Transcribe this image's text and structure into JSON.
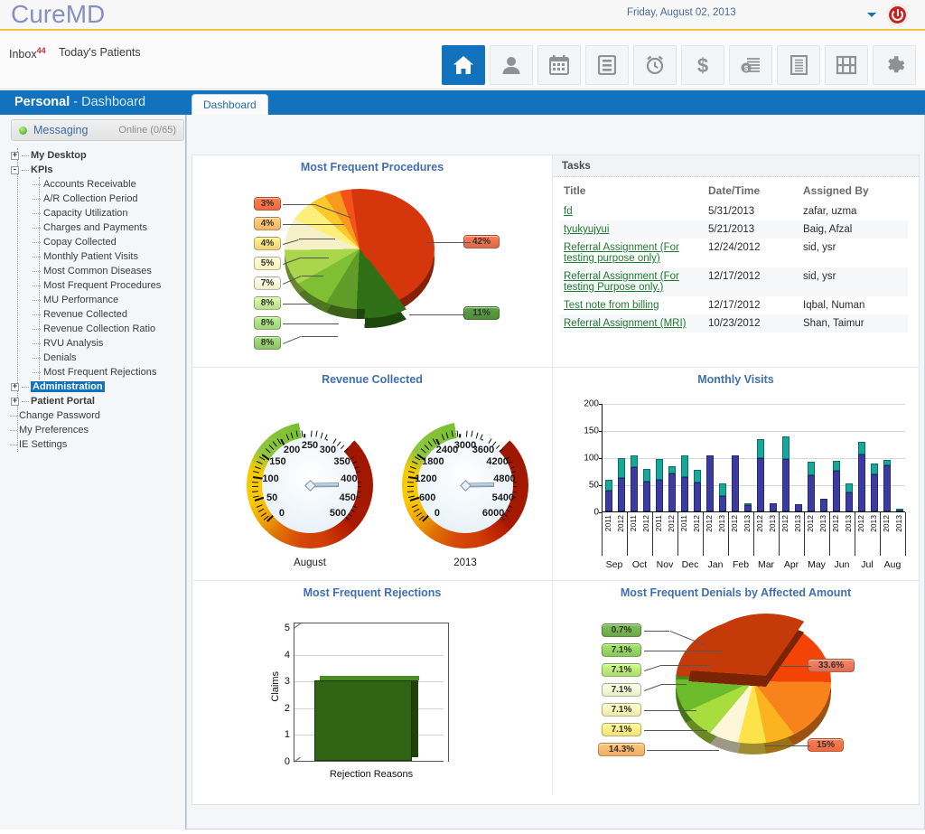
{
  "app": {
    "brand": "CureMD",
    "date": "Friday, August 02, 2013",
    "power_icon": "power-icon",
    "caret_icon": "chevron-down-icon"
  },
  "navbar": {
    "inbox_label": "Inbox",
    "inbox_count": "44",
    "todays_patients": "Today's Patients",
    "toolbar": [
      {
        "name": "home-icon",
        "label": "Home",
        "active": true
      },
      {
        "name": "patient-icon",
        "label": "Patients",
        "active": false
      },
      {
        "name": "calendar-icon",
        "label": "Scheduler",
        "active": false
      },
      {
        "name": "server-icon",
        "label": "Records",
        "active": false
      },
      {
        "name": "alarm-clock-icon",
        "label": "Reminders",
        "active": false
      },
      {
        "name": "dollar-icon",
        "label": "Billing",
        "active": false
      },
      {
        "name": "invoice-icon",
        "label": "Claims",
        "active": false
      },
      {
        "name": "document-icon",
        "label": "Reports",
        "active": false
      },
      {
        "name": "film-icon",
        "label": "Media",
        "active": false
      },
      {
        "name": "gear-icon",
        "label": "Settings",
        "active": false
      }
    ]
  },
  "sidebar": {
    "header_bold": "Personal",
    "header_rest": " - Dashboard",
    "messaging": {
      "label": "Messaging",
      "status": "Online (0/65)"
    },
    "tree": [
      {
        "label": "My Desktop",
        "level": 0,
        "expander": "+",
        "bold": true,
        "highlight": false
      },
      {
        "label": "KPIs",
        "level": 0,
        "expander": "-",
        "bold": true,
        "highlight": false
      },
      {
        "label": "Accounts Receivable",
        "level": 1,
        "expander": "",
        "bold": false,
        "highlight": false
      },
      {
        "label": "A/R Collection Period",
        "level": 1,
        "expander": "",
        "bold": false,
        "highlight": false
      },
      {
        "label": "Capacity Utilization",
        "level": 1,
        "expander": "",
        "bold": false,
        "highlight": false
      },
      {
        "label": "Charges and Payments",
        "level": 1,
        "expander": "",
        "bold": false,
        "highlight": false
      },
      {
        "label": "Copay Collected",
        "level": 1,
        "expander": "",
        "bold": false,
        "highlight": false
      },
      {
        "label": "Monthly Patient Visits",
        "level": 1,
        "expander": "",
        "bold": false,
        "highlight": false
      },
      {
        "label": "Most Common Diseases",
        "level": 1,
        "expander": "",
        "bold": false,
        "highlight": false
      },
      {
        "label": "Most Frequent Procedures",
        "level": 1,
        "expander": "",
        "bold": false,
        "highlight": false
      },
      {
        "label": "MU Performance",
        "level": 1,
        "expander": "",
        "bold": false,
        "highlight": false
      },
      {
        "label": "Revenue Collected",
        "level": 1,
        "expander": "",
        "bold": false,
        "highlight": false
      },
      {
        "label": "Revenue Collection Ratio",
        "level": 1,
        "expander": "",
        "bold": false,
        "highlight": false
      },
      {
        "label": "RVU Analysis",
        "level": 1,
        "expander": "",
        "bold": false,
        "highlight": false
      },
      {
        "label": "Denials",
        "level": 1,
        "expander": "",
        "bold": false,
        "highlight": false
      },
      {
        "label": "Most Frequent Rejections",
        "level": 1,
        "expander": "",
        "bold": false,
        "highlight": false
      },
      {
        "label": "Administration",
        "level": 0,
        "expander": "+",
        "bold": true,
        "highlight": true
      },
      {
        "label": "Patient Portal",
        "level": 0,
        "expander": "+",
        "bold": true,
        "highlight": false
      },
      {
        "label": "Change Password",
        "level": 2,
        "expander": "",
        "bold": false,
        "highlight": false
      },
      {
        "label": "My Preferences",
        "level": 2,
        "expander": "",
        "bold": false,
        "highlight": false
      },
      {
        "label": "IE Settings",
        "level": 2,
        "expander": "",
        "bold": false,
        "highlight": false
      }
    ]
  },
  "main": {
    "tab_label": "Dashboard",
    "tasks": {
      "panel_title": "Tasks",
      "columns": [
        "Title",
        "Date/Time",
        "Assigned By"
      ],
      "rows": [
        {
          "title": "fd",
          "date": "5/31/2013",
          "assigned_by": "zafar, uzma"
        },
        {
          "title": "tyukyujyui",
          "date": "5/21/2013",
          "assigned_by": "Baig, Afzal"
        },
        {
          "title": "Referral Assignment (For testing purpose only)",
          "date": "12/24/2012",
          "assigned_by": "sid, ysr"
        },
        {
          "title": "Referral Assignment (For testing Purpose only.)",
          "date": "12/17/2012",
          "assigned_by": "sid, ysr"
        },
        {
          "title": "Test note from billing",
          "date": "12/17/2012",
          "assigned_by": "Iqbal, Numan"
        },
        {
          "title": "Referral Assignment (MRI)",
          "date": "10/23/2012",
          "assigned_by": "Shan, Taimur"
        }
      ]
    }
  },
  "chart_data": [
    {
      "id": "most-frequent-procedures",
      "type": "pie",
      "title": "Most Frequent Procedures",
      "labels": [
        "42%",
        "11%",
        "8%",
        "8%",
        "8%",
        "7%",
        "5%",
        "4%",
        "4%",
        "3%"
      ],
      "values": [
        42,
        11,
        8,
        8,
        8,
        7,
        5,
        4,
        4,
        3
      ],
      "colors": [
        "#d6360c",
        "#2f6f16",
        "#5f9c28",
        "#7fbf34",
        "#a9d64a",
        "#f6f0c8",
        "#fcf07a",
        "#fcc82c",
        "#f79a1e",
        "#f4521a"
      ],
      "label_colors": [
        "#d96a4a",
        "#4f8c3a",
        "#8fc06a",
        "#9ed07a",
        "#b9dc8e",
        "#eeeecb",
        "#f4f1b8",
        "#f2cf7a",
        "#f3b368",
        "#ec6a3f"
      ],
      "legend": "none",
      "exploded_slice": "11%"
    },
    {
      "id": "revenue-collected",
      "type": "gauge",
      "title": "Revenue Collected",
      "gauges": [
        {
          "caption": "August",
          "ticks": [
            "0",
            "50",
            "100",
            "150",
            "200",
            "250",
            "300",
            "350",
            "400",
            "450",
            "500"
          ],
          "min": 0,
          "max": 500,
          "value": 415
        },
        {
          "caption": "2013",
          "ticks": [
            "0",
            "600",
            "1200",
            "1800",
            "2400",
            "3000",
            "3600",
            "4200",
            "4800",
            "5400",
            "6000"
          ],
          "min": 0,
          "max": 6000,
          "value": 4980
        }
      ]
    },
    {
      "id": "monthly-visits",
      "type": "bar",
      "title": "Monthly Visits",
      "ylabel": "",
      "xlabel": "",
      "ylim": [
        0,
        200
      ],
      "yticks": [
        0,
        50,
        100,
        150,
        200
      ],
      "grid": true,
      "months": [
        "Sep",
        "Oct",
        "Nov",
        "Dec",
        "Jan",
        "Feb",
        "Mar",
        "Apr",
        "May",
        "Jun",
        "Jul",
        "Aug"
      ],
      "categories": [
        "Sep 2011",
        "Sep 2012",
        "Oct 2011",
        "Oct 2012",
        "Nov 2011",
        "Nov 2012",
        "Dec 2011",
        "Dec 2012",
        "Jan 2012",
        "Jan 2013",
        "Feb 2012",
        "Feb 2013",
        "Mar 2012",
        "Mar 2013",
        "Apr 2012",
        "Apr 2013",
        "May 2012",
        "May 2013",
        "Jun 2012",
        "Jun 2013",
        "Jul 2012",
        "Jul 2013",
        "Aug 2012",
        "Aug 2013"
      ],
      "year_labels": [
        "2011",
        "2012",
        "2011",
        "2012",
        "2011",
        "2012",
        "2011",
        "2012",
        "2012",
        "2013",
        "2012",
        "2013",
        "2012",
        "2013",
        "2012",
        "2013",
        "2012",
        "2013",
        "2012",
        "2013",
        "2012",
        "2013",
        "2012",
        "2013"
      ],
      "series": [
        {
          "name": "lower",
          "color": "#3c3c9e",
          "values": [
            38,
            61,
            81,
            55,
            58,
            70,
            63,
            53,
            103,
            28,
            103,
            12,
            98,
            15,
            96,
            13,
            66,
            23,
            75,
            35,
            105,
            69,
            85,
            1
          ]
        },
        {
          "name": "upper",
          "color": "#19a79a",
          "values": [
            21,
            37,
            22,
            23,
            38,
            13,
            40,
            23,
            0,
            24,
            0,
            3,
            35,
            0,
            42,
            0,
            26,
            0,
            19,
            17,
            24,
            20,
            10,
            1
          ]
        }
      ],
      "totals": [
        59,
        98,
        103,
        78,
        96,
        83,
        103,
        76,
        103,
        52,
        103,
        15,
        133,
        15,
        138,
        13,
        92,
        23,
        94,
        52,
        129,
        89,
        95,
        2
      ]
    },
    {
      "id": "most-frequent-rejections",
      "type": "bar",
      "title": "Most Frequent Rejections",
      "ylabel": "Claims",
      "xlabel": "Rejection Reasons",
      "categories": [
        "Rejection Reasons"
      ],
      "values": [
        3
      ],
      "ylim": [
        0,
        5
      ],
      "yticks": [
        0,
        1,
        2,
        3,
        4,
        5
      ],
      "bar_color": "#2f6413",
      "grid": true
    },
    {
      "id": "most-frequent-denials",
      "type": "pie",
      "title": "Most Frequent Denials by Affected Amount",
      "labels": [
        "33.6%",
        "15%",
        "14.3%",
        "7.1%",
        "7.1%",
        "7.1%",
        "7.1%",
        "7.1%",
        "0.7%"
      ],
      "values": [
        33.6,
        15,
        14.3,
        7.1,
        7.1,
        7.1,
        7.1,
        7.1,
        0.7
      ],
      "colors": [
        "#c43a08",
        "#f44307",
        "#f8821c",
        "#fbb420",
        "#fde34a",
        "#fdf6d8",
        "#a8dd3e",
        "#6cbb2a",
        "#3f8a18"
      ],
      "label_colors": [
        "#da7054",
        "#ee6a42",
        "#efab66",
        "#f4e07c",
        "#eee9aa",
        "#e4eec4",
        "#aed972",
        "#8cc55c",
        "#6ca64a"
      ],
      "legend": "none",
      "exploded_slice": "33.6%"
    }
  ]
}
